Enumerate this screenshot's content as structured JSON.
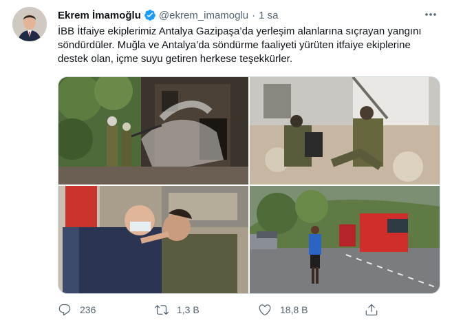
{
  "tweet": {
    "author_name": "Ekrem İmamoğlu",
    "handle": "@ekrem_imamoglu",
    "separator": "·",
    "time": "1 sa",
    "text": "İBB İtfaiye ekiplerimiz Antalya Gazipaşa’da yerleşim alanlarına sıçrayan yangını söndürdüler. Muğla ve Antalya’da söndürme faaliyeti yürüten itfaiye ekiplerine destek olan, içme suyu getiren herkese teşekkürler."
  },
  "media": {
    "photos": [
      {
        "name": "firefighters-spraying-house-photo"
      },
      {
        "name": "firefighters-resting-photo"
      },
      {
        "name": "eye-treatment-photo"
      },
      {
        "name": "road-water-delivery-photo"
      }
    ]
  },
  "actions": {
    "reply_count": "236",
    "retweet_count": "1,3 B",
    "like_count": "18,8 B"
  },
  "colors": {
    "text": "#0f1419",
    "secondary": "#536471",
    "verified": "#1d9bf0"
  }
}
